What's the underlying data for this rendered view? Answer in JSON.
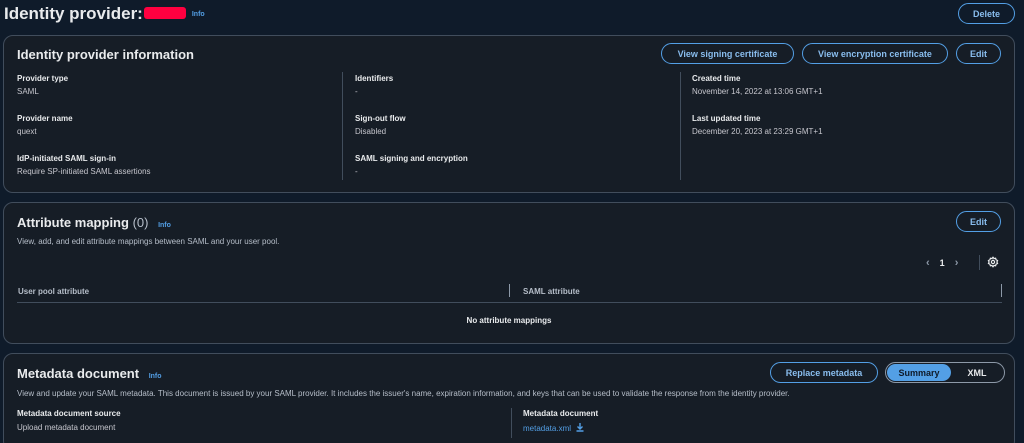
{
  "header": {
    "title": "Identity provider:",
    "info": "Info",
    "delete": "Delete"
  },
  "info_panel": {
    "title": "Identity provider information",
    "buttons": {
      "signing": "View signing certificate",
      "encryption": "View encryption certificate",
      "edit": "Edit"
    },
    "col1": [
      {
        "label": "Provider type",
        "value": "SAML"
      },
      {
        "label": "Provider name",
        "value": "quext"
      },
      {
        "label": "IdP-initiated SAML sign-in",
        "value": "Require SP-initiated SAML assertions"
      }
    ],
    "col2": [
      {
        "label": "Identifiers",
        "value": "-"
      },
      {
        "label": "Sign-out flow",
        "value": "Disabled"
      },
      {
        "label": "SAML signing and encryption",
        "value": "-"
      }
    ],
    "col3": [
      {
        "label": "Created time",
        "value": "November 14, 2022 at 13:06 GMT+1"
      },
      {
        "label": "Last updated time",
        "value": "December 20, 2023 at 23:29 GMT+1"
      }
    ]
  },
  "mapping_panel": {
    "title": "Attribute mapping",
    "count": "(0)",
    "info": "Info",
    "description": "View, add, and edit attribute mappings between SAML and your user pool.",
    "edit": "Edit",
    "page": "1",
    "columns": [
      "User pool attribute",
      "SAML attribute"
    ],
    "empty": "No attribute mappings"
  },
  "metadata_panel": {
    "title": "Metadata document",
    "info": "Info",
    "description": "View and update your SAML metadata. This document is issued by your SAML provider. It includes the issuer's name, expiration information, and keys that can be used to validate the response from the identity provider.",
    "replace": "Replace metadata",
    "seg_summary": "Summary",
    "seg_xml": "XML",
    "source_label": "Metadata document source",
    "source_value": "Upload metadata document",
    "doc_label": "Metadata document",
    "doc_link": "metadata.xml"
  }
}
